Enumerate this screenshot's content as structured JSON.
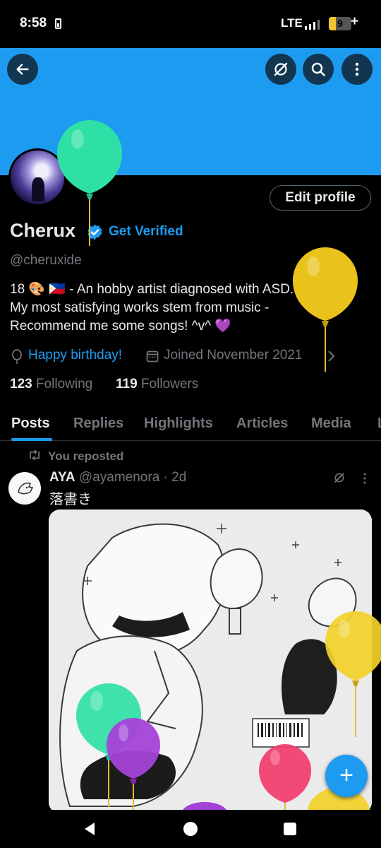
{
  "status_bar": {
    "time": "8:58",
    "network": "LTE",
    "battery_level": "9",
    "battery_fraction": 0.09,
    "charging_symbol": "+"
  },
  "colors": {
    "accent": "#1d9bf0",
    "background": "#000000",
    "text_primary": "#e7e9ea",
    "text_secondary": "#71767b",
    "border": "#2f3336"
  },
  "header": {
    "icons": {
      "back": "arrow-left-icon",
      "grok": "grok-icon",
      "search": "search-icon",
      "more": "more-vertical-icon"
    }
  },
  "profile": {
    "edit_button": "Edit profile",
    "name": "Cherux",
    "verified_icon": "verified-badge-icon",
    "get_verified": "Get Verified",
    "handle": "@cheruxide",
    "bio_lines": [
      "18 🎨 🇵🇭 - An hobby artist diagnosed with ASD.",
      "My most satisfying works stem from music -",
      "Recommend me some songs! ^v^ 💜"
    ],
    "birthday": "Happy birthday!",
    "joined": "Joined November 2021",
    "following_count": "123",
    "following_label": "Following",
    "followers_count": "119",
    "followers_label": "Followers"
  },
  "tabs": [
    "Posts",
    "Replies",
    "Highlights",
    "Articles",
    "Media",
    "L"
  ],
  "active_tab": "Posts",
  "post": {
    "repost_label": "You reposted",
    "author_name": "AYA",
    "author_handle": "@ayamenora",
    "time": "· 2d",
    "text": "落書き",
    "image_label": "Sketch illustration"
  },
  "fab": {
    "label": "+"
  },
  "balloon_colors": [
    "#2fe0a6",
    "#f0c419",
    "#a442d8",
    "#f23b6b"
  ]
}
